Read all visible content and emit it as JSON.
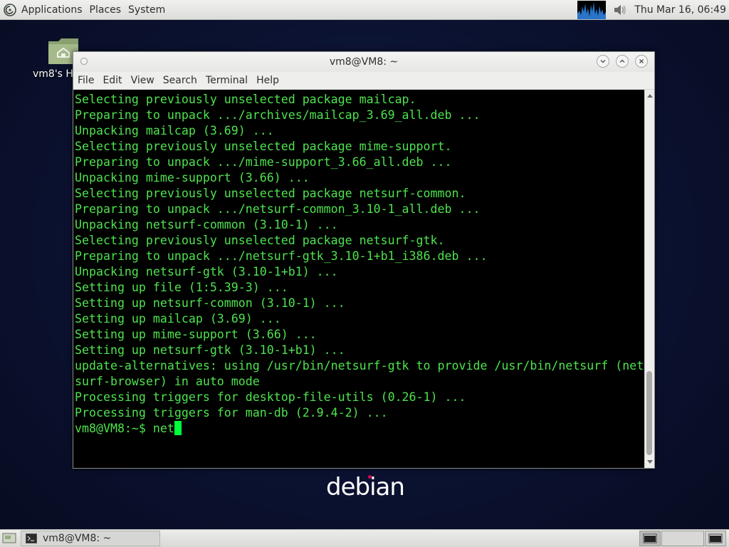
{
  "top_panel": {
    "menus": [
      "Applications",
      "Places",
      "System"
    ],
    "clock": "Thu Mar 16, 06:49",
    "icons": {
      "menu_logo": "debian-swirl-icon",
      "volume": "speaker-icon",
      "monitor": "system-monitor-graph"
    }
  },
  "desktop": {
    "icons": [
      {
        "label": "vm8's H",
        "icon": "home-folder-icon"
      }
    ],
    "wallpaper_logo": "debian"
  },
  "terminal": {
    "title": "vm8@VM8: ~",
    "menu": [
      "File",
      "Edit",
      "View",
      "Search",
      "Terminal",
      "Help"
    ],
    "lines": [
      "Selecting previously unselected package mailcap.",
      "Preparing to unpack .../archives/mailcap_3.69_all.deb ...",
      "Unpacking mailcap (3.69) ...",
      "Selecting previously unselected package mime-support.",
      "Preparing to unpack .../mime-support_3.66_all.deb ...",
      "Unpacking mime-support (3.66) ...",
      "Selecting previously unselected package netsurf-common.",
      "Preparing to unpack .../netsurf-common_3.10-1_all.deb ...",
      "Unpacking netsurf-common (3.10-1) ...",
      "Selecting previously unselected package netsurf-gtk.",
      "Preparing to unpack .../netsurf-gtk_3.10-1+b1_i386.deb ...",
      "Unpacking netsurf-gtk (3.10-1+b1) ...",
      "Setting up file (1:5.39-3) ...",
      "Setting up netsurf-common (3.10-1) ...",
      "Setting up mailcap (3.69) ...",
      "Setting up mime-support (3.66) ...",
      "Setting up netsurf-gtk (3.10-1+b1) ...",
      "update-alternatives: using /usr/bin/netsurf-gtk to provide /usr/bin/netsurf (net",
      "surf-browser) in auto mode",
      "Processing triggers for desktop-file-utils (0.26-1) ...",
      "Processing triggers for man-db (2.9.4-2) ..."
    ],
    "prompt": "vm8@VM8:~$ ",
    "input": "net",
    "text_color": "#4ee34e",
    "background": "#000000"
  },
  "bottom_panel": {
    "task": "vm8@VM8: ~"
  }
}
